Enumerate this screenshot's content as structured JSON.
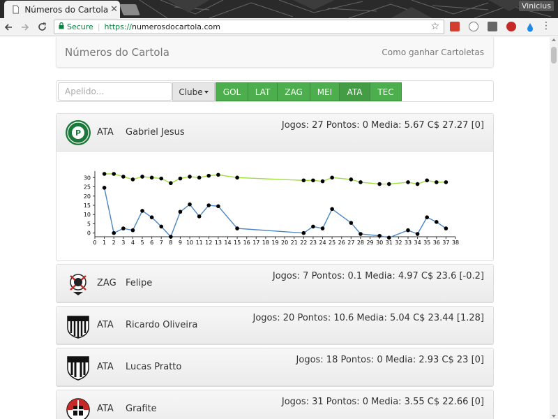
{
  "browser": {
    "tab_title": "Números do Cartola",
    "tab_close": "✕",
    "user_name": "Vinicius",
    "secure_label": "Secure",
    "url_scheme": "https://",
    "url_host": "numerosdocartola.com"
  },
  "navbar": {
    "brand": "Números do Cartola",
    "link": "Como ganhar Cartoletas"
  },
  "filters": {
    "search_placeholder": "Apelido...",
    "clube_label": "Clube",
    "positions": [
      "GOL",
      "LAT",
      "ZAG",
      "MEI",
      "ATA",
      "TEC"
    ],
    "active_position": "ATA",
    "accent_color": "#4cae4c"
  },
  "players": [
    {
      "position": "ATA",
      "name": "Gabriel Jesus",
      "stats": "Jogos: 27 Pontos: 0 Media: 5.67 C$ 27.27 [0]",
      "club_icon": "palmeiras-crest-icon",
      "expanded": true
    },
    {
      "position": "ZAG",
      "name": "Felipe",
      "stats": "Jogos: 7 Pontos: 0.1 Media: 4.97 C$ 23.6 [-0.2]",
      "club_icon": "corinthians-crest-icon",
      "expanded": false
    },
    {
      "position": "ATA",
      "name": "Ricardo Oliveira",
      "stats": "Jogos: 20 Pontos: 10.6 Media: 5.04 C$ 23.44 [1.28]",
      "club_icon": "santos-crest-icon",
      "expanded": false
    },
    {
      "position": "ATA",
      "name": "Lucas Pratto",
      "stats": "Jogos: 18 Pontos: 0 Media: 2.93 C$ 23 [0]",
      "club_icon": "atletico-mg-crest-icon",
      "expanded": false
    },
    {
      "position": "ATA",
      "name": "Grafite",
      "stats": "Jogos: 31 Pontos: 0 Media: 3.55 C$ 22.66 [0]",
      "club_icon": "santa-cruz-crest-icon",
      "expanded": false
    }
  ],
  "chart_data": {
    "type": "line",
    "title": "",
    "xlabel": "",
    "ylabel": "",
    "xlim": [
      0,
      38
    ],
    "ylim": [
      -2,
      32
    ],
    "x_ticks": [
      0,
      1,
      2,
      3,
      4,
      5,
      6,
      7,
      8,
      9,
      10,
      11,
      12,
      13,
      14,
      15,
      16,
      17,
      18,
      19,
      20,
      21,
      22,
      23,
      24,
      25,
      26,
      27,
      28,
      29,
      30,
      31,
      32,
      33,
      34,
      35,
      36,
      37,
      38
    ],
    "y_ticks": [
      0,
      5,
      10,
      15,
      20,
      25,
      30
    ],
    "grid": false,
    "series": [
      {
        "color": "#9ee03a",
        "x": [
          1,
          2,
          3,
          4,
          5,
          6,
          7,
          8,
          9,
          10,
          11,
          12,
          13,
          15,
          22,
          23,
          24,
          25,
          27,
          28,
          30,
          31,
          33,
          34,
          35,
          36,
          37
        ],
        "y": [
          32,
          32,
          30.5,
          29,
          30.5,
          30,
          29.5,
          27,
          29.5,
          30.5,
          30,
          31,
          31.5,
          30,
          28.5,
          28.5,
          28,
          30,
          29,
          27.5,
          26.5,
          26.5,
          27.5,
          26.5,
          28.5,
          27.5,
          27.5
        ]
      },
      {
        "color": "#4a86c5",
        "x": [
          1,
          2,
          3,
          4,
          5,
          6,
          7,
          8,
          9,
          10,
          11,
          12,
          13,
          15,
          22,
          23,
          24,
          25,
          27,
          28,
          30,
          31,
          33,
          34,
          35,
          36,
          37
        ],
        "y": [
          24.5,
          0,
          2.5,
          1.5,
          12,
          8.5,
          3.5,
          -2,
          11.5,
          15.5,
          9,
          15,
          14.5,
          2.5,
          0,
          3.5,
          2.5,
          13,
          5.5,
          -0.5,
          -1.5,
          -2.5,
          1.5,
          -0.5,
          8.5,
          6,
          2.5
        ]
      }
    ]
  }
}
